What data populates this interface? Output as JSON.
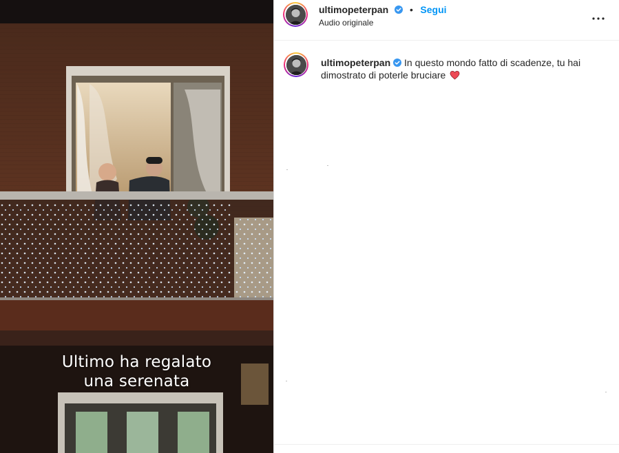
{
  "post": {
    "username": "ultimopeterpan",
    "follow_label": "Segui",
    "separator": "•",
    "audio_label": "Audio originale",
    "media_caption_lines": [
      "Ultimo ha regalato",
      "una serenata"
    ]
  },
  "comment": {
    "username": "ultimopeterpan",
    "text": "In questo mondo fatto di scadenze, tu hai dimostrato di poterle bruciare"
  },
  "colors": {
    "accent": "#0095f6",
    "heart": "#ed4956",
    "verified": "#3897f0"
  },
  "icons": [
    "verified-badge-icon",
    "more-options-icon",
    "red-heart-icon"
  ]
}
